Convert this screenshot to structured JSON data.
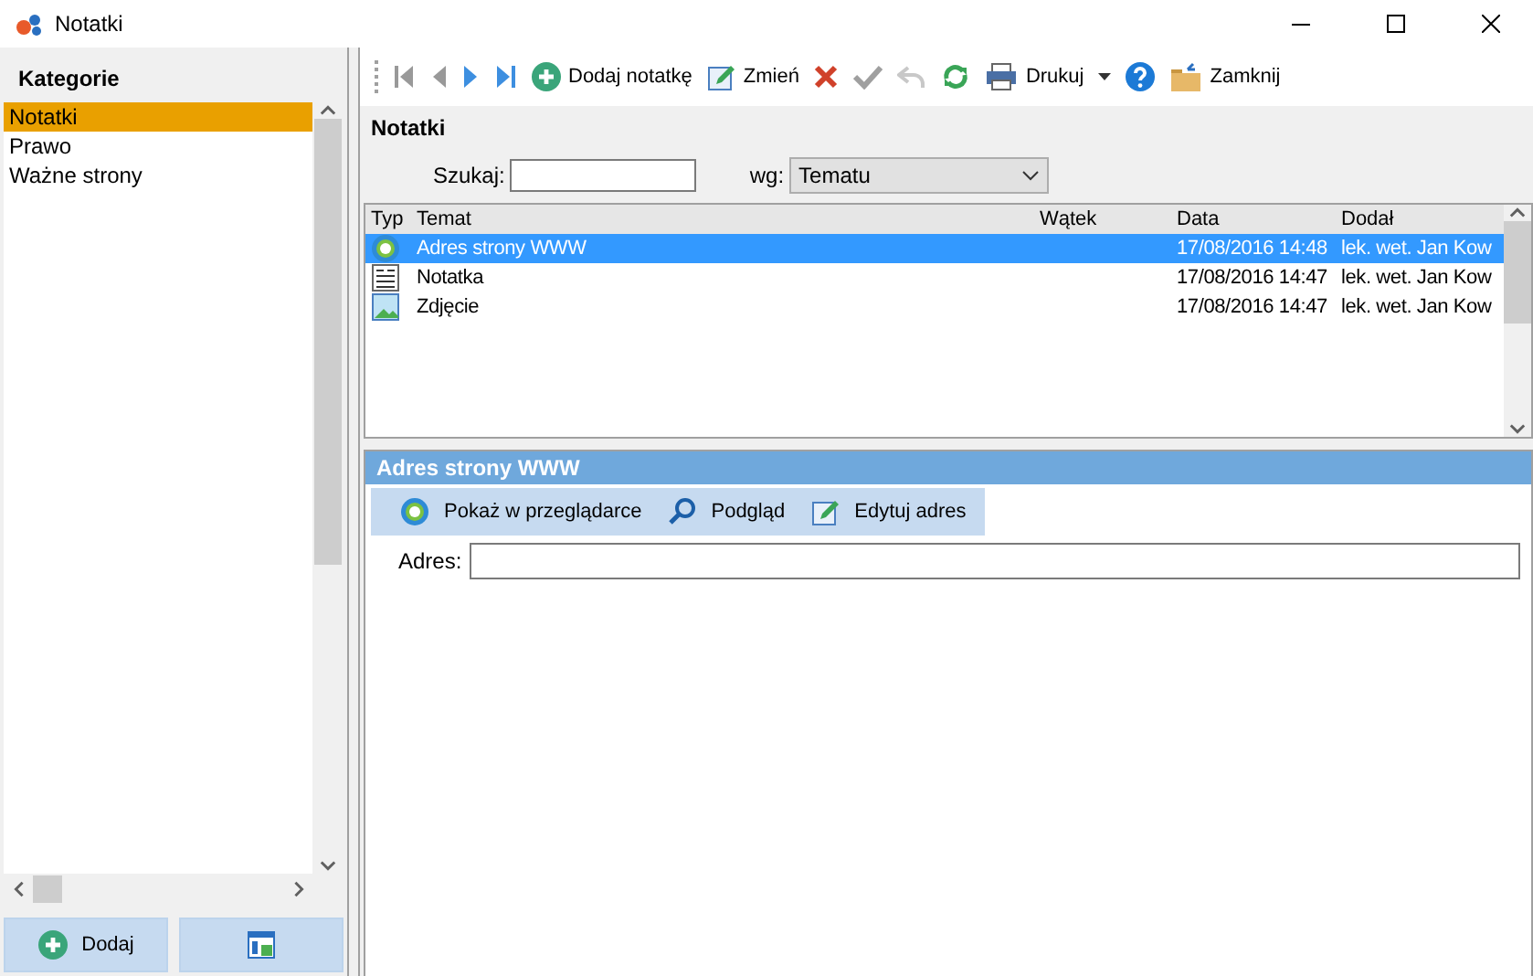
{
  "window": {
    "title": "Notatki"
  },
  "sidebar": {
    "title": "Kategorie",
    "items": [
      {
        "label": "Notatki",
        "selected": true
      },
      {
        "label": "Prawo",
        "selected": false
      },
      {
        "label": "Ważne strony",
        "selected": false
      }
    ],
    "buttons": [
      {
        "kind": "add",
        "label": "Dodaj"
      },
      {
        "kind": "layout"
      }
    ]
  },
  "toolbar": [
    {
      "kind": "first"
    },
    {
      "kind": "prev"
    },
    {
      "kind": "next"
    },
    {
      "kind": "last"
    },
    {
      "kind": "add",
      "label": "Dodaj notatkę"
    },
    {
      "kind": "edit",
      "label": "Zmień"
    },
    {
      "kind": "delete"
    },
    {
      "kind": "check",
      "disabled": true
    },
    {
      "kind": "undo",
      "disabled": true
    },
    {
      "kind": "refresh"
    },
    {
      "kind": "print",
      "label": "Drukuj"
    },
    {
      "kind": "dropdown"
    },
    {
      "kind": "help"
    },
    {
      "kind": "close",
      "label": "Zamknij"
    }
  ],
  "section_title": "Notatki",
  "search": {
    "label": "Szukaj:",
    "sort_label": "wg:",
    "sort_value": "Tematu"
  },
  "table": {
    "columns": [
      "Typ",
      "Temat",
      "Wątek",
      "Data",
      "Dodał"
    ],
    "rows": [
      {
        "kind": "www",
        "topic": "Adres strony WWW",
        "date": "17/08/2016 14:48",
        "author": "lek. wet. Jan Kow",
        "selected": true
      },
      {
        "kind": "note",
        "topic": "Notatka",
        "date": "17/08/2016 14:47",
        "author": "lek. wet. Jan Kow",
        "selected": false
      },
      {
        "kind": "photo",
        "topic": "Zdjęcie",
        "date": "17/08/2016 14:47",
        "author": "lek. wet. Jan Kow",
        "selected": false
      }
    ]
  },
  "detail": {
    "title": "Adres strony WWW",
    "actions": [
      {
        "kind": "www",
        "label": "Pokaż w przeglądarce"
      },
      {
        "kind": "search",
        "label": "Podgląd"
      },
      {
        "kind": "edit",
        "label": "Edytuj adres"
      }
    ],
    "field_label": "Adres:"
  }
}
